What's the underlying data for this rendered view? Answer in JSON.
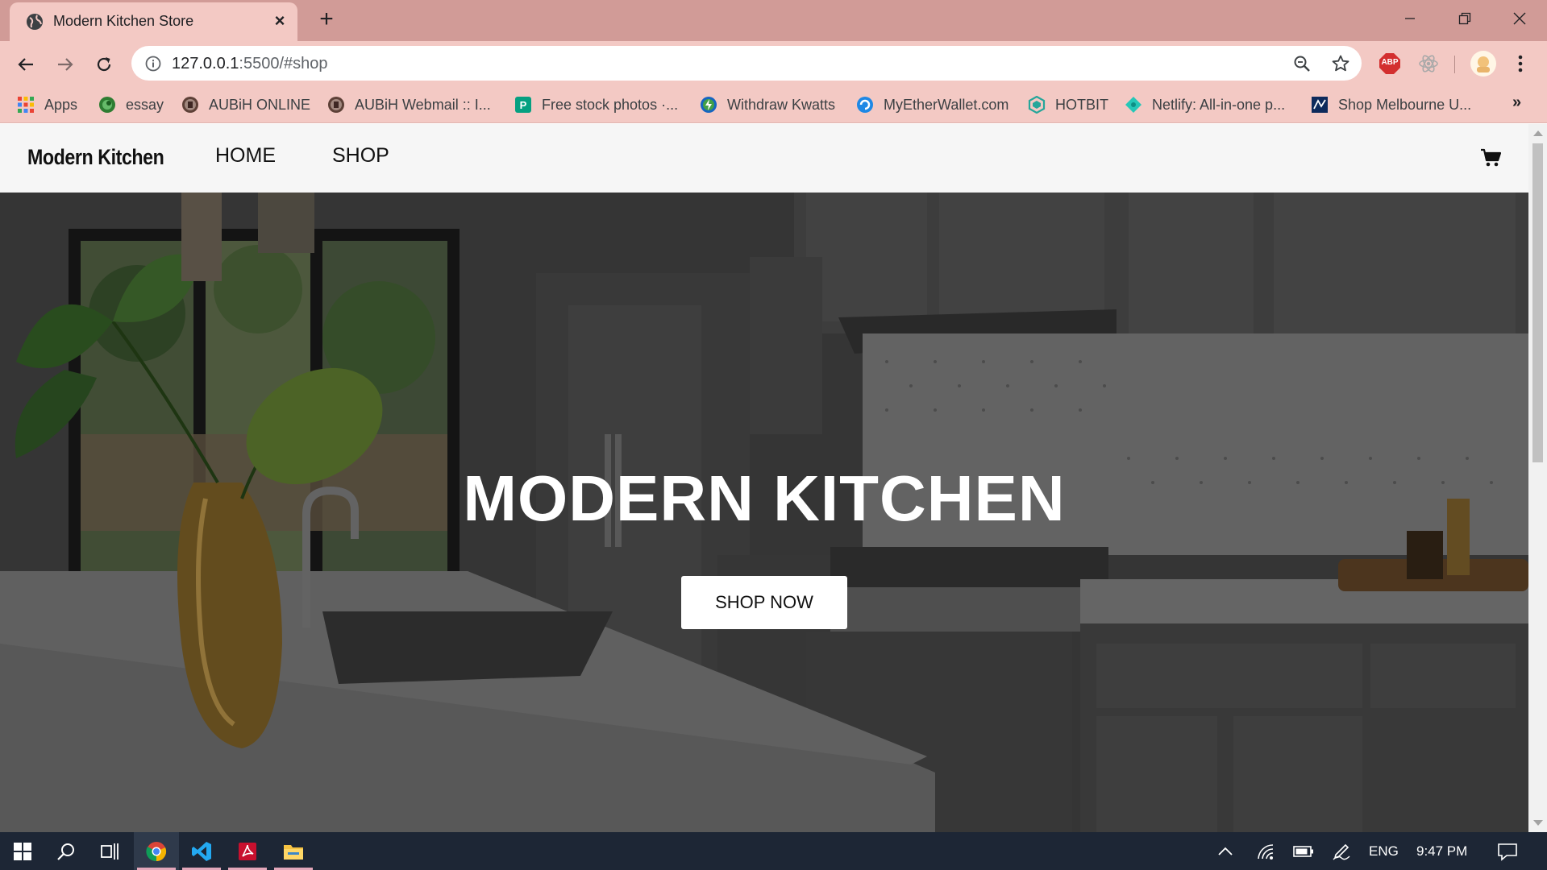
{
  "browser": {
    "tab_title": "Modern Kitchen Store",
    "new_tab": "+",
    "url_host": "127.0.0.1",
    "url_rest": ":5500/#shop",
    "extension_abp": "ABP"
  },
  "bookmarks": [
    {
      "label": "Apps",
      "icon": "apps-grid-icon"
    },
    {
      "label": "essay",
      "icon": "essay-icon"
    },
    {
      "label": "AUBiH ONLINE",
      "icon": "aubih-icon"
    },
    {
      "label": "AUBiH Webmail :: I...",
      "icon": "aubih-webmail-icon"
    },
    {
      "label": "Free stock photos ·...",
      "icon": "pexels-icon"
    },
    {
      "label": "Withdraw Kwatts",
      "icon": "kwatts-icon"
    },
    {
      "label": "MyEtherWallet.com",
      "icon": "myetherwallet-icon"
    },
    {
      "label": "HOTBIT",
      "icon": "hotbit-icon"
    },
    {
      "label": "Netlify: All-in-one p...",
      "icon": "netlify-icon"
    },
    {
      "label": "Shop Melbourne U...",
      "icon": "melbourne-icon"
    }
  ],
  "site": {
    "brand": "Modern Kitchen",
    "nav": [
      "HOME",
      "SHOP"
    ],
    "hero_title": "MODERN KITCHEN",
    "hero_button": "SHOP NOW"
  },
  "taskbar": {
    "language": "ENG",
    "time": "9:47 PM"
  },
  "colors": {
    "titlebar": "#d19b97",
    "tab": "#f3c9c4",
    "taskbar": "#1d2635"
  }
}
